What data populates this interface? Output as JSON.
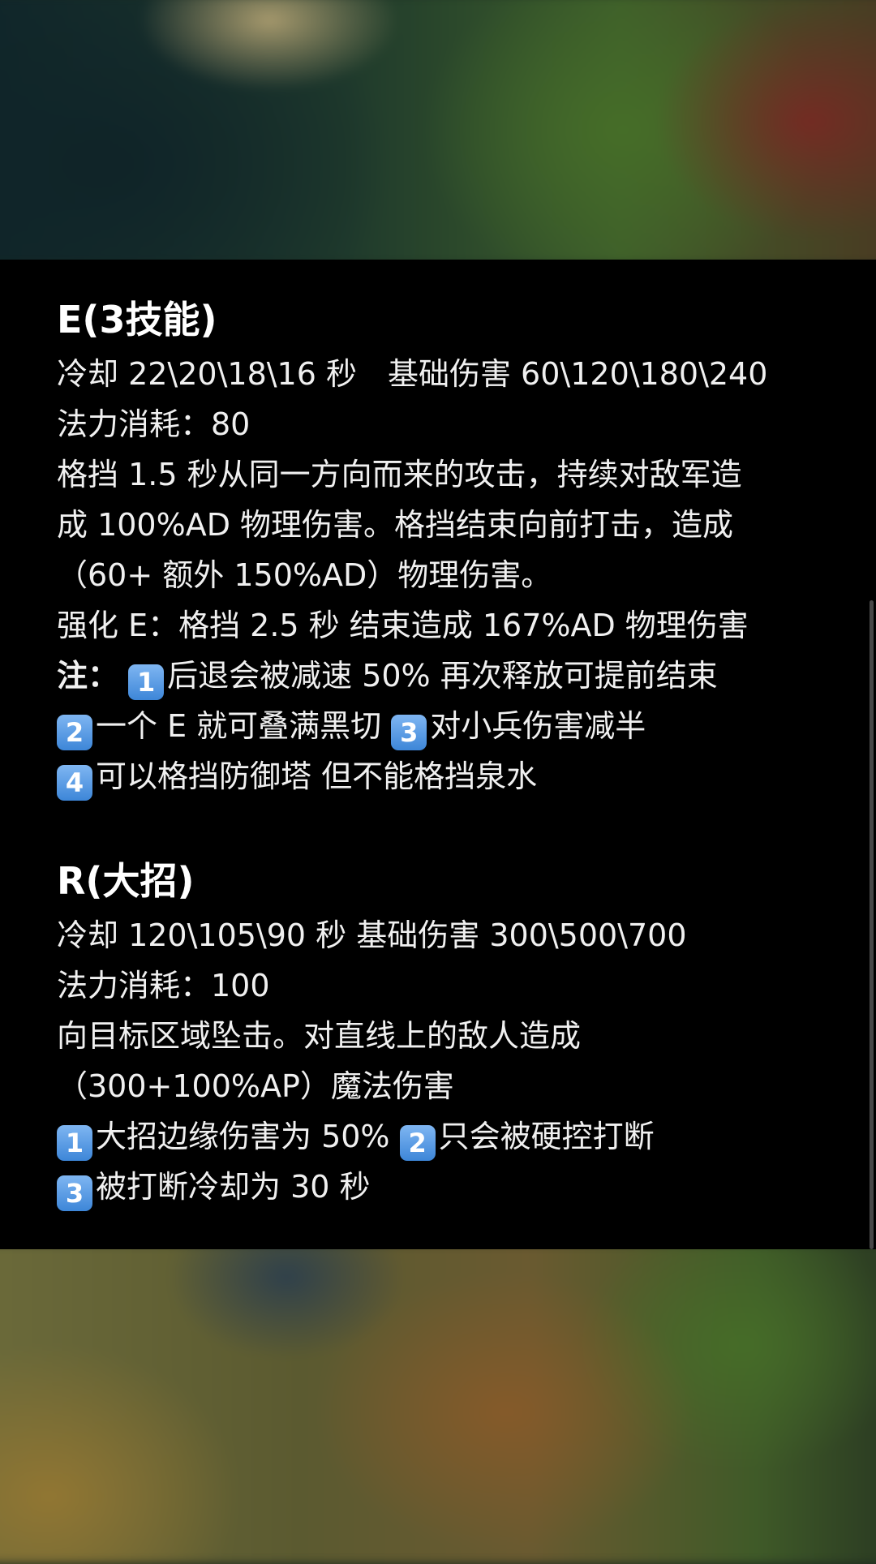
{
  "e_skill": {
    "title": "E(3技能)",
    "cooldown_line": "冷却 22\\20\\18\\16 秒　基础伤害 60\\120\\180\\240",
    "mana_line": "法力消耗：80",
    "desc_line1": "格挡 1.5 秒从同一方向而来的攻击，持续对敌军造",
    "desc_line2": "成 100%AD 物理伤害。格挡结束向前打击，造成",
    "desc_line3": "（60+ 额外 150%AD）物理伤害。",
    "enhanced_line": "强化 E：格挡 2.5 秒 结束造成 167%AD 物理伤害",
    "note_label": "注：",
    "notes": [
      {
        "badge": "1",
        "text": "后退会被减速 50%  再次释放可提前结束"
      },
      {
        "badge": "2",
        "text": "一个 E 就可叠满黑切 "
      },
      {
        "badge": "3",
        "text": "对小兵伤害减半"
      },
      {
        "badge": "4",
        "text": "可以格挡防御塔 但不能格挡泉水"
      }
    ]
  },
  "r_skill": {
    "title": "R(大招)",
    "cooldown_line": "冷却 120\\105\\90 秒 基础伤害 300\\500\\700",
    "mana_line": "法力消耗：100",
    "desc_line1": "向目标区域坠击。对直线上的敌人造成",
    "desc_line2": "（300+100%AP）魔法伤害",
    "notes": [
      {
        "badge": "1",
        "text": "大招边缘伤害为 50% "
      },
      {
        "badge": "2",
        "text": "只会被硬控打断"
      },
      {
        "badge": "3",
        "text": "被打断冷却为 30 秒"
      }
    ]
  }
}
